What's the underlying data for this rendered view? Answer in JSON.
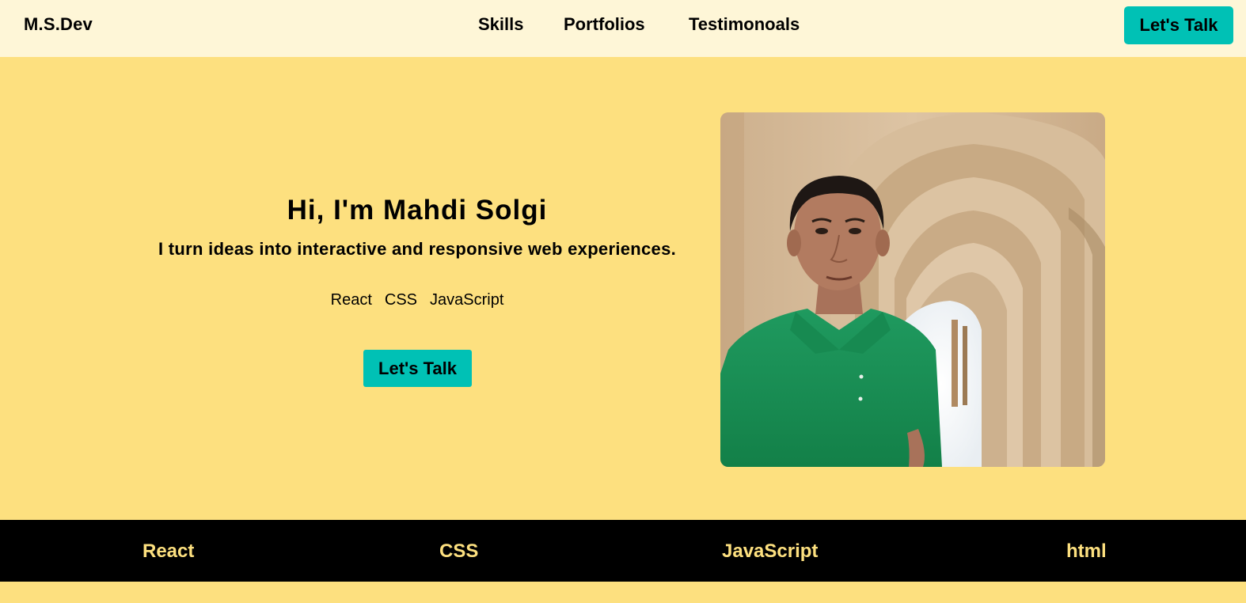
{
  "header": {
    "logo": "M.S.Dev",
    "nav": [
      "Skills",
      "Portfolios",
      "Testimonoals"
    ],
    "cta_label": "Let's Talk"
  },
  "hero": {
    "title": "Hi, I'm Mahdi Solgi",
    "subtitle": "I turn ideas into interactive and responsive web experiences.",
    "tags": [
      "React",
      "CSS",
      "JavaScript"
    ],
    "cta_label": "Let's Talk"
  },
  "skills_bar": [
    "React",
    "CSS",
    "JavaScript",
    "html"
  ],
  "colors": {
    "background": "#fde07f",
    "header_background": "#fef6d7",
    "accent": "#00c1b5",
    "skills_bar_background": "#000000",
    "skills_bar_text": "#fde07f"
  }
}
